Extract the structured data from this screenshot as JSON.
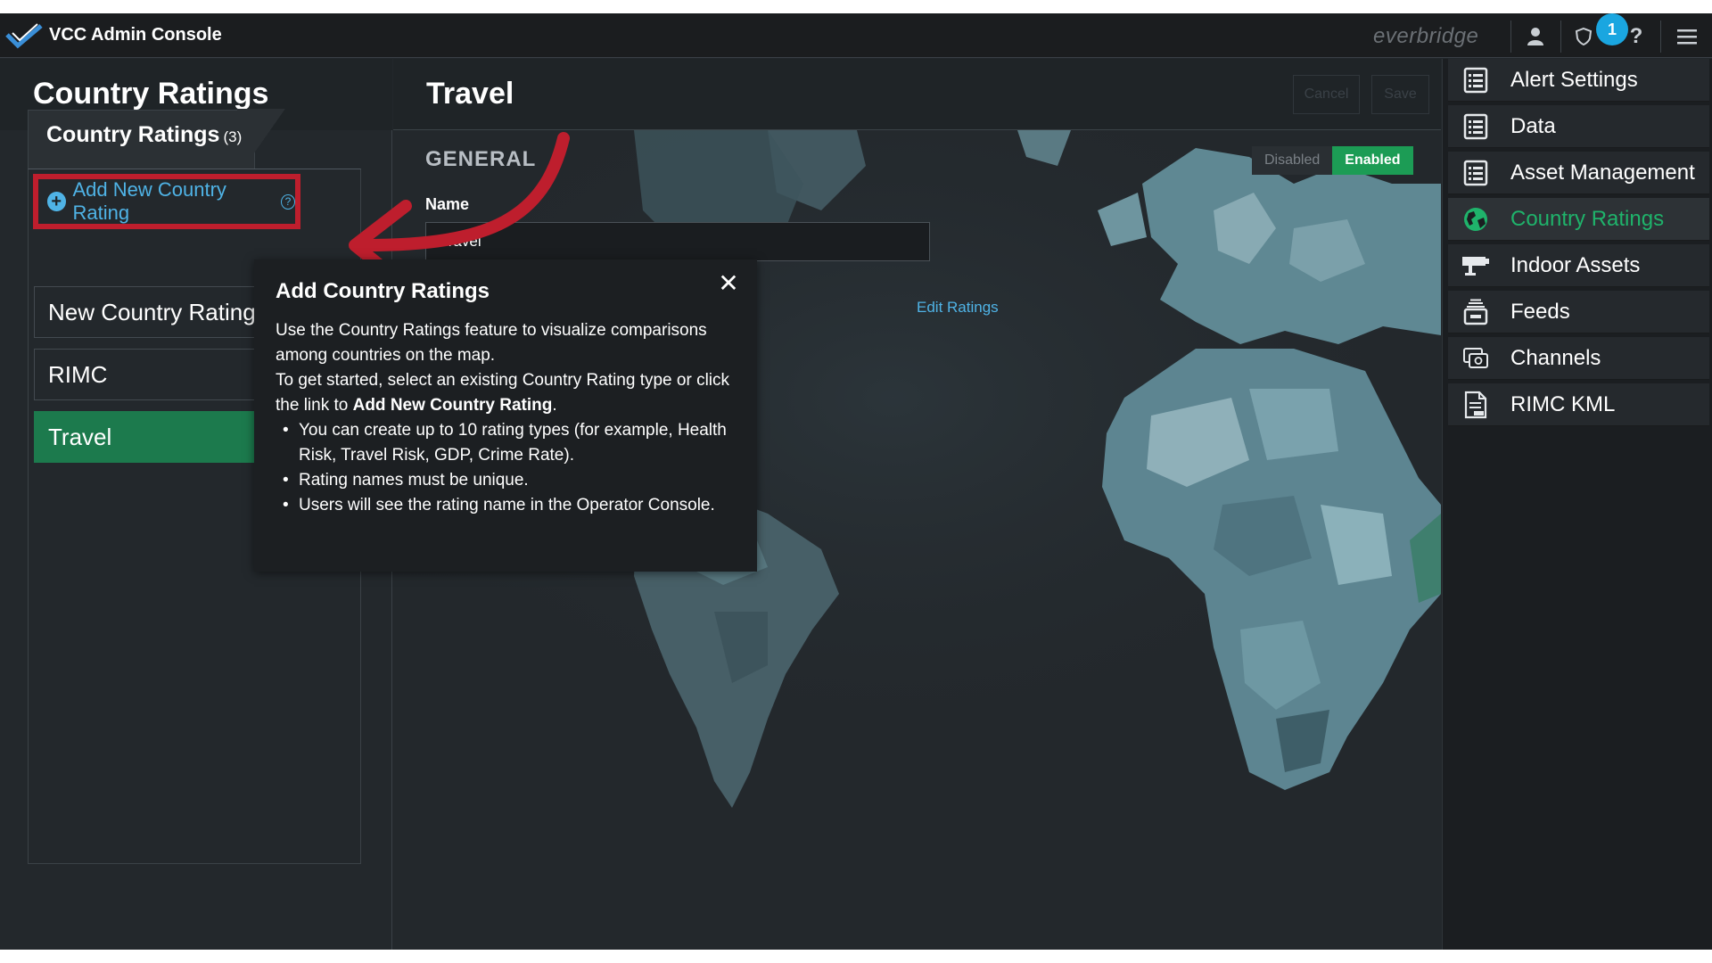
{
  "app": {
    "title": "VCC Admin Console",
    "brand": "everbridge",
    "notification_count": "1"
  },
  "left": {
    "title": "Country Ratings",
    "tab_label": "Country Ratings",
    "tab_count": "(3)",
    "add_link": "Add New Country Rating",
    "items": [
      "New Country Rating",
      "RIMC",
      "Travel"
    ]
  },
  "main": {
    "title": "Travel",
    "cancel": "Cancel",
    "save": "Save",
    "section": "GENERAL",
    "name_label": "Name",
    "name_value": "Travel",
    "edit_ratings": "Edit Ratings",
    "toggle_off": "Disabled",
    "toggle_on": "Enabled"
  },
  "popover": {
    "title": "Add Country Ratings",
    "p1": "Use the Country Ratings feature to visualize comparisons among countries on the map.",
    "p2_start": "To get started, select an existing Country Rating type or click the link to ",
    "p2_bold": "Add New Country Rating",
    "p2_end": ".",
    "bullets": [
      "You can create up to 10 rating types (for example, Health Risk, Travel Risk, GDP, Crime Rate).",
      "Rating names must be unique.",
      "Users will see the rating name in the Operator Console."
    ]
  },
  "sidebar": {
    "items": [
      {
        "label": "Alert Settings",
        "icon": "list-icon"
      },
      {
        "label": "Data",
        "icon": "list-icon"
      },
      {
        "label": "Asset Management",
        "icon": "list-icon"
      },
      {
        "label": "Country Ratings",
        "icon": "globe-icon",
        "active": true
      },
      {
        "label": "Indoor Assets",
        "icon": "camera-icon"
      },
      {
        "label": "Feeds",
        "icon": "feed-icon"
      },
      {
        "label": "Channels",
        "icon": "channels-icon"
      },
      {
        "label": "RIMC KML",
        "icon": "kml-file-icon"
      }
    ]
  },
  "colors": {
    "accent_green": "#1fb36b",
    "link_blue": "#4fb3e6",
    "highlight_red": "#be1e2d",
    "active_item": "#1c7a4d"
  }
}
